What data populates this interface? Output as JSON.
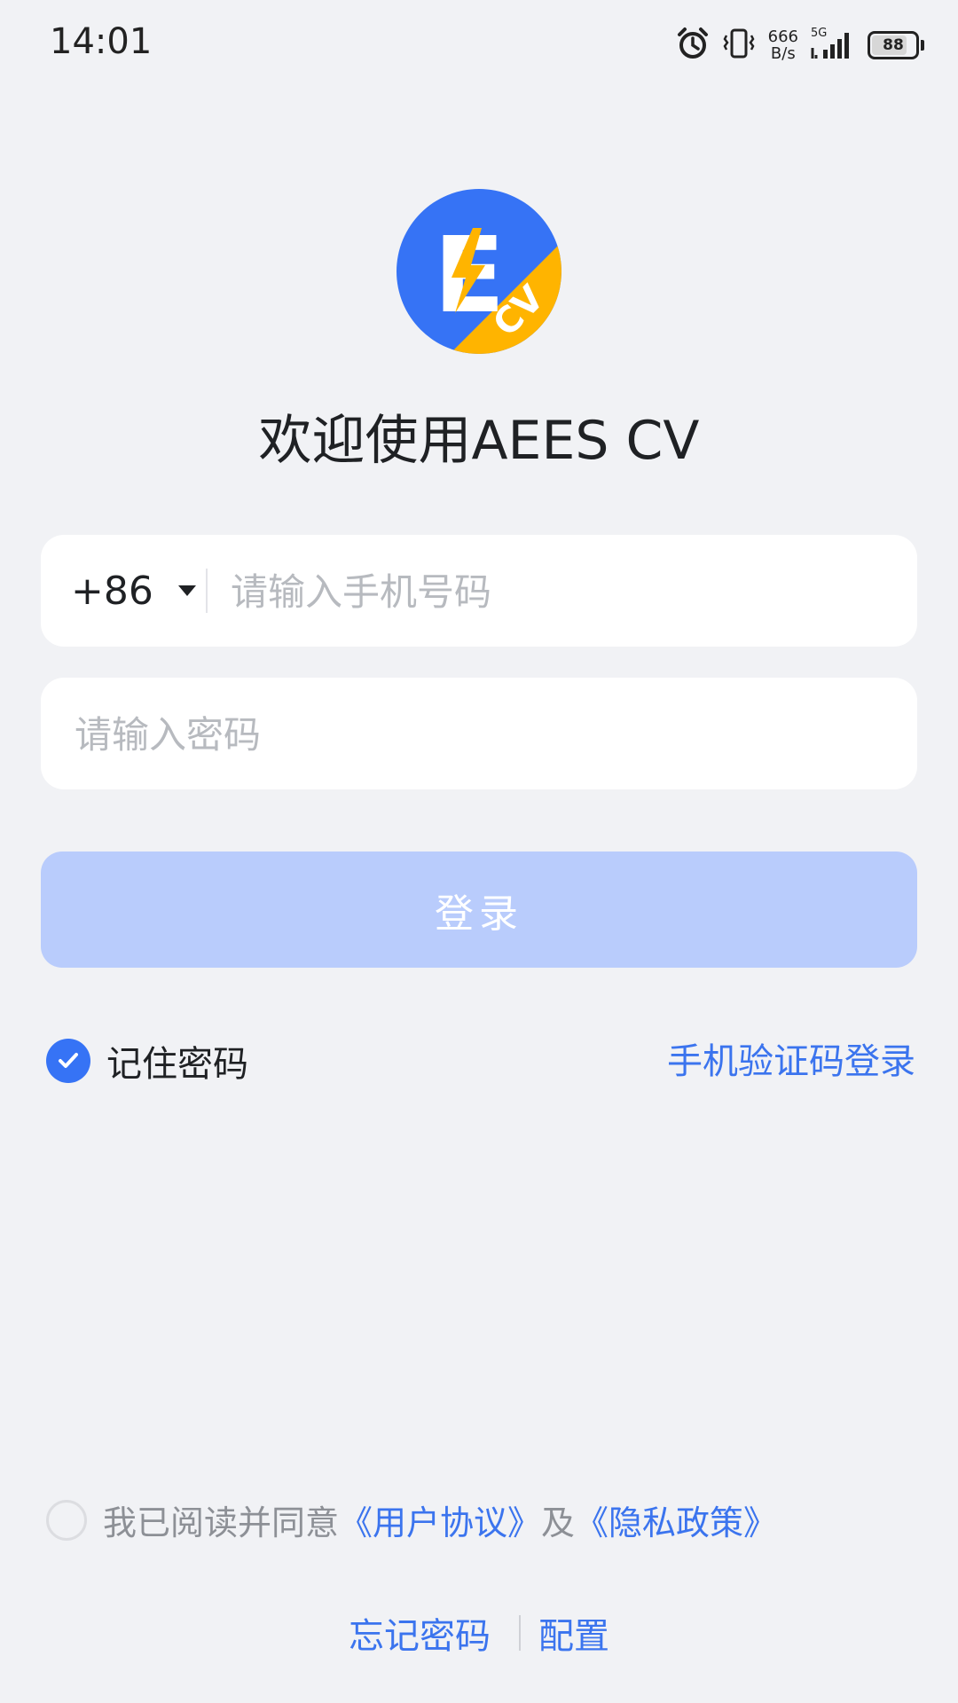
{
  "status_bar": {
    "time": "14:01",
    "net_speed_value": "666",
    "net_speed_unit": "B/s",
    "network_type": "5G",
    "battery_percent": "88",
    "icons": [
      "alarm-icon",
      "vibrate-icon",
      "signal-icon",
      "battery-icon"
    ]
  },
  "app": {
    "logo_letter": "E",
    "logo_sub": "CV",
    "welcome_title": "欢迎使用AEES CV",
    "brand_color": "#3673f5",
    "accent_color": "#ffb400"
  },
  "login_form": {
    "country_code": "+86",
    "phone_placeholder": "请输入手机号码",
    "password_placeholder": "请输入密码",
    "login_label": "登录",
    "remember_label": "记住密码",
    "remember_checked": true,
    "sms_login_label": "手机验证码登录"
  },
  "agreement": {
    "text": "我已阅读并同意",
    "user_agreement_label": "《用户协议》",
    "and_text": "及",
    "privacy_policy_label": "《隐私政策》",
    "checked": false
  },
  "footer": {
    "forgot_password_label": "忘记密码",
    "config_label": "配置"
  }
}
